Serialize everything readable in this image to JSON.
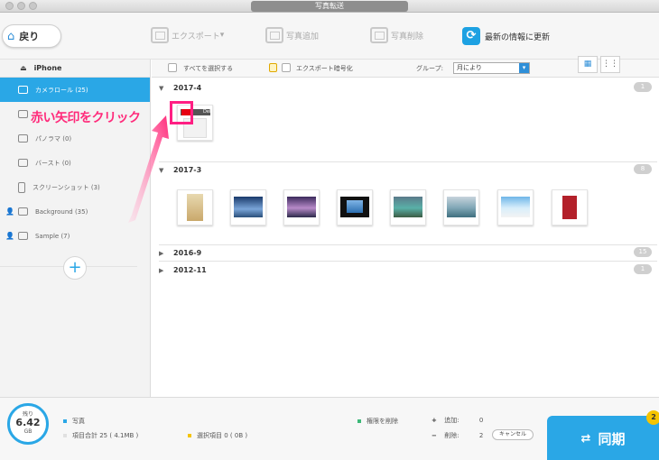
{
  "window": {
    "title": "写真転送"
  },
  "toolbar": {
    "back_label": "戻り",
    "export_label": "エクスポート",
    "add_label": "写真追加",
    "delete_label": "写真削除",
    "refresh_label": "最新の情報に更新"
  },
  "sidebar": {
    "device": "iPhone",
    "items": [
      {
        "label": "カメラロール (25)"
      },
      {
        "label": ""
      },
      {
        "label": "パノラマ (0)"
      },
      {
        "label": "バースト (0)"
      },
      {
        "label": "スクリーンショット (3)"
      },
      {
        "label": "Background (35)"
      },
      {
        "label": "Sample (7)"
      }
    ]
  },
  "mainbar": {
    "select_all": "すべてを選択する",
    "export_encrypt": "エクスポート暗号化",
    "group_label": "グループ:",
    "group_value": "月により"
  },
  "groups": [
    {
      "name": "2017-4",
      "count": "1"
    },
    {
      "name": "2017-3",
      "count": "8"
    },
    {
      "name": "2016-9",
      "count": "15"
    },
    {
      "name": "2012-11",
      "count": "1"
    }
  ],
  "annotation": {
    "text": "赤い矢印をクリック"
  },
  "thumb_label": "Del",
  "bottom": {
    "storage_label": "残り",
    "storage_value": "6.42",
    "storage_unit": "GB",
    "photos_legend": "写真",
    "items_total": "項目合計 25 ( 4.1MB )",
    "selected_items": "選択項目 0 ( 0B )",
    "delete_rights": "権限を削除",
    "add_label": "追加:",
    "add_value": "0",
    "delete_label": "削除:",
    "delete_value": "2",
    "cancel_label": "キャンセル",
    "sync_label": "同期",
    "badge": "2"
  },
  "colors": {
    "accent": "#2aa7e6",
    "annotation": "#ff2a7a",
    "badge": "#f5c400"
  }
}
